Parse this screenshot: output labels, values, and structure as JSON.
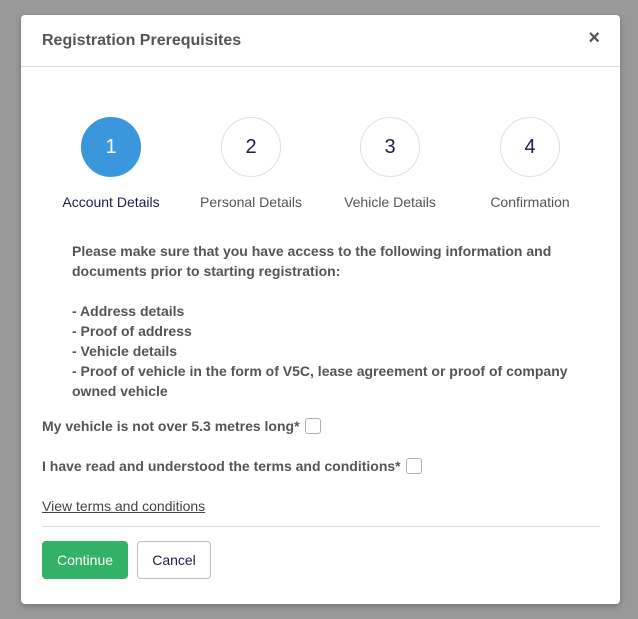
{
  "modal": {
    "title": "Registration Prerequisites",
    "close_icon": "×"
  },
  "steps": [
    {
      "number": "1",
      "label": "Account Details",
      "active": true
    },
    {
      "number": "2",
      "label": "Personal Details",
      "active": false
    },
    {
      "number": "3",
      "label": "Vehicle Details",
      "active": false
    },
    {
      "number": "4",
      "label": "Confirmation",
      "active": false
    }
  ],
  "info": {
    "intro": "Please make sure that you have access to the following information and documents prior to starting registration:",
    "items": [
      "- Address details",
      "- Proof of address",
      "- Vehicle details",
      "- Proof of vehicle in the form of V5C, lease agreement or proof of company owned vehicle"
    ]
  },
  "checks": [
    {
      "label": "My vehicle is not over 5.3 metres long*",
      "checked": false
    },
    {
      "label": "I have read and understood the terms and conditions*",
      "checked": false
    }
  ],
  "terms_link": "View terms and conditions",
  "buttons": {
    "continue": "Continue",
    "cancel": "Cancel"
  },
  "colors": {
    "active_step": "#3a97dc",
    "continue": "#33b166"
  }
}
